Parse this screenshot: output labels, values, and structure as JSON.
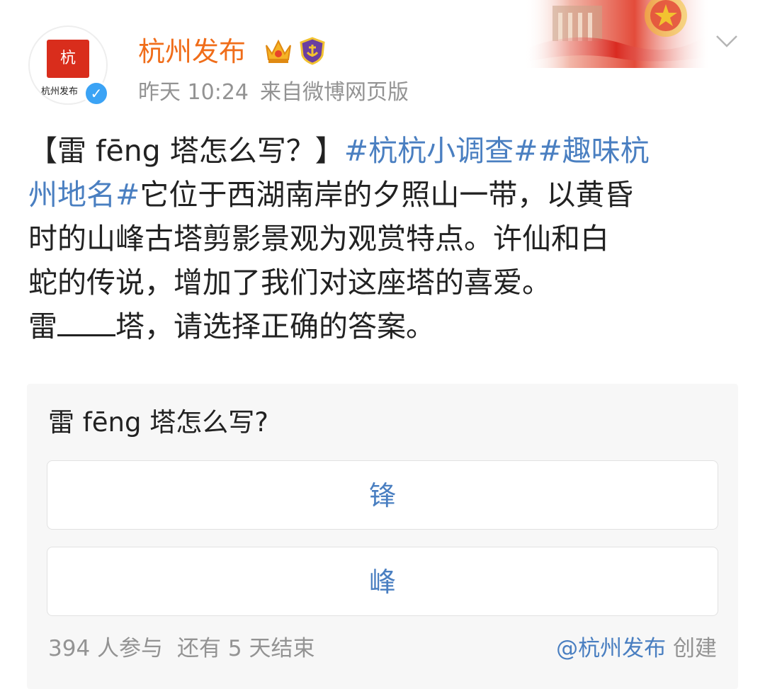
{
  "header": {
    "author_name": "杭州发布",
    "avatar_logo_text": "杭",
    "avatar_caption": "杭州发布",
    "verified_mark": "✓",
    "timestamp": "昨天 10:24",
    "source": "来自微博网页版",
    "badges": [
      "crown-icon",
      "shield-icon"
    ],
    "name_color": "#f06d1a"
  },
  "post": {
    "lines": [
      [
        {
          "text": "【雷 fēng 塔怎么写？】",
          "type": "text"
        },
        {
          "text": "#杭杭小调查##趣味杭",
          "type": "topic"
        }
      ],
      [
        {
          "text": "州地名#",
          "type": "topic"
        },
        {
          "text": "它位于西湖南岸的夕照山一带，以黄昏",
          "type": "text"
        }
      ],
      [
        {
          "text": "时的山峰古塔剪影景观为观赏特点。许仙和白",
          "type": "text"
        }
      ],
      [
        {
          "text": "蛇的传说，增加了我们对这座塔的喜爱。",
          "type": "text"
        }
      ],
      [
        {
          "text": "雷",
          "type": "text"
        },
        {
          "text": "",
          "type": "blank"
        },
        {
          "text": "塔，请选择正确的答案。",
          "type": "text"
        }
      ]
    ],
    "topic_color": "#4a7fc1"
  },
  "poll": {
    "question": "雷 fēng 塔怎么写?",
    "options": [
      "锋",
      "峰"
    ],
    "participants": "394 人参与",
    "time_left": "还有 5 天结束",
    "creator": "@杭州发布",
    "creator_suffix": "创建"
  }
}
